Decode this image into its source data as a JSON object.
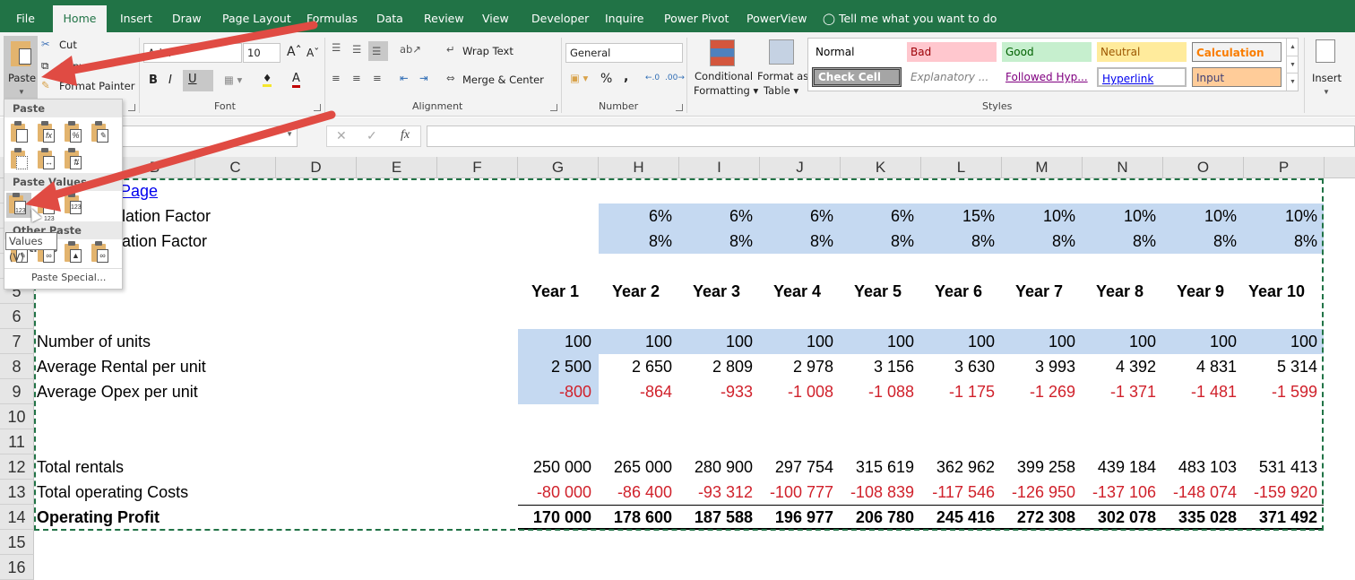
{
  "tabs": [
    {
      "label": "File",
      "active": false
    },
    {
      "label": "Home",
      "active": true
    },
    {
      "label": "Insert",
      "active": false
    },
    {
      "label": "Draw",
      "active": false
    },
    {
      "label": "Page Layout",
      "active": false
    },
    {
      "label": "Formulas",
      "active": false
    },
    {
      "label": "Data",
      "active": false
    },
    {
      "label": "Review",
      "active": false
    },
    {
      "label": "View",
      "active": false
    },
    {
      "label": "Developer",
      "active": false
    },
    {
      "label": "Inquire",
      "active": false
    },
    {
      "label": "Power Pivot",
      "active": false
    },
    {
      "label": "PowerView",
      "active": false
    }
  ],
  "tell_me": "Tell me what you want to do",
  "clipboard": {
    "paste": "Paste",
    "cut": "Cut",
    "copy": "Copy",
    "format_painter": "Format Painter"
  },
  "font": {
    "name": "Arial",
    "size": "10",
    "bold": "B",
    "italic": "I",
    "underline": "U",
    "group_label": "Font"
  },
  "alignment": {
    "wrap_text": "Wrap Text",
    "merge_center": "Merge & Center",
    "group_label": "Alignment"
  },
  "number": {
    "format": "General",
    "percent": "%",
    "comma": ",",
    "group_label": "Number"
  },
  "styles": {
    "conditional_formatting_1": "Conditional",
    "conditional_formatting_2": "Formatting",
    "format_as_table_1": "Format as",
    "format_as_table_2": "Table",
    "cells": [
      {
        "label": "Normal"
      },
      {
        "label": "Bad"
      },
      {
        "label": "Good"
      },
      {
        "label": "Neutral"
      },
      {
        "label": "Calculation"
      },
      {
        "label": "Check Cell"
      },
      {
        "label": "Explanatory ..."
      },
      {
        "label": "Followed Hyp..."
      },
      {
        "label": "Hyperlink"
      },
      {
        "label": "Input"
      }
    ],
    "group_label": "Styles"
  },
  "cells_group": {
    "insert": "Insert"
  },
  "formula_bar": {
    "fx": "fx",
    "cancel": "✕",
    "enter": "✓",
    "value": ""
  },
  "paste_menu": {
    "paste_header": "Paste",
    "paste_values_header": "Paste Values",
    "other_header": "Other Paste Options",
    "paste_special": "Paste Special...",
    "tooltip": "Values (V)"
  },
  "columns": [
    "B",
    "C",
    "D",
    "E",
    "F",
    "G",
    "H",
    "I",
    "J",
    "K",
    "L",
    "M",
    "N",
    "O",
    "P"
  ],
  "rows": [
    "5",
    "6",
    "7",
    "8",
    "9",
    "10",
    "11",
    "12",
    "13",
    "14",
    "15",
    "16"
  ],
  "sheet": {
    "link_text": "Page",
    "inflation_label": "lation Factor",
    "escalation_label": "ation Factor",
    "inflation": [
      "6%",
      "6%",
      "6%",
      "6%",
      "15%",
      "10%",
      "10%",
      "10%",
      "10%"
    ],
    "escalation": [
      "8%",
      "8%",
      "8%",
      "8%",
      "8%",
      "8%",
      "8%",
      "8%",
      "8%"
    ],
    "years": [
      "Year 1",
      "Year 2",
      "Year 3",
      "Year 4",
      "Year 5",
      "Year 6",
      "Year 7",
      "Year 8",
      "Year 9",
      "Year 10"
    ],
    "lines": [
      {
        "label": "Number of units",
        "values": [
          "100",
          "100",
          "100",
          "100",
          "100",
          "100",
          "100",
          "100",
          "100",
          "100"
        ],
        "negative": false,
        "bold": false
      },
      {
        "label": "Average Rental per unit",
        "values": [
          "2 500",
          "2 650",
          "2 809",
          "2 978",
          "3 156",
          "3 630",
          "3 993",
          "4 392",
          "4 831",
          "5 314"
        ],
        "negative": false,
        "bold": false
      },
      {
        "label": "Average Opex per unit",
        "values": [
          "-800",
          "-864",
          "-933",
          "-1 008",
          "-1 088",
          "-1 175",
          "-1 269",
          "-1 371",
          "-1 481",
          "-1 599"
        ],
        "negative": true,
        "bold": false
      },
      {
        "label": "Total rentals",
        "values": [
          "250 000",
          "265 000",
          "280 900",
          "297 754",
          "315 619",
          "362 962",
          "399 258",
          "439 184",
          "483 103",
          "531 413"
        ],
        "negative": false,
        "bold": false
      },
      {
        "label": "Total operating Costs",
        "values": [
          "-80 000",
          "-86 400",
          "-93 312",
          "-100 777",
          "-108 839",
          "-117 546",
          "-126 950",
          "-137 106",
          "-148 074",
          "-159 920"
        ],
        "negative": true,
        "bold": false
      },
      {
        "label": "Operating Profit",
        "values": [
          "170 000",
          "178 600",
          "187 588",
          "196 977",
          "206 780",
          "245 416",
          "272 308",
          "302 078",
          "335 028",
          "371 492"
        ],
        "negative": false,
        "bold": true
      }
    ]
  },
  "colors": {
    "ribbon_green": "#217346",
    "input_fill": "#c5d9f1",
    "negative_red": "#d0212b",
    "annotation_arrow": "#e04b43"
  }
}
